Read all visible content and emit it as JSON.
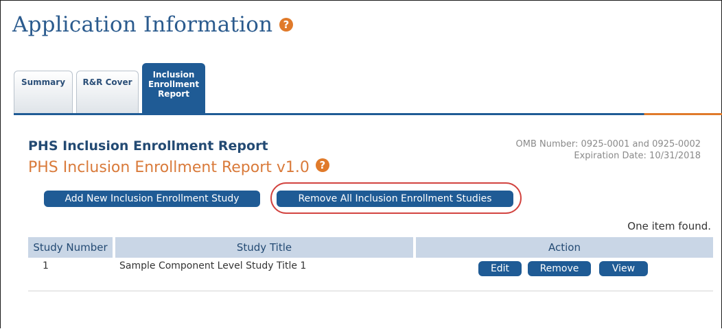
{
  "header": {
    "title": "Application Information",
    "help_icon": "?"
  },
  "tabs": [
    {
      "label": "Summary",
      "active": false
    },
    {
      "label": "R&R Cover",
      "active": false
    },
    {
      "label": "Inclusion Enrollment Report",
      "active": true
    }
  ],
  "report": {
    "title": "PHS Inclusion Enrollment Report",
    "subtitle": "PHS Inclusion Enrollment Report v1.0",
    "help_icon": "?",
    "omb_number": "OMB Number: 0925-0001 and 0925-0002",
    "expiration": "Expiration Date: 10/31/2018"
  },
  "actions": {
    "add_label": "Add New Inclusion Enrollment Study",
    "remove_all_label": "Remove All Inclusion Enrollment Studies"
  },
  "table": {
    "found_text": "One item found.",
    "columns": [
      "Study Number",
      "Study Title",
      "Action"
    ],
    "rows": [
      {
        "number": "1",
        "title": "Sample Component Level Study Title 1",
        "actions": [
          "Edit",
          "Remove",
          "View"
        ]
      }
    ]
  },
  "colors": {
    "accent": "#1f5b95",
    "highlight": "#d2433f",
    "subtitle": "#d97a3a",
    "header_bg": "#c9d6e6"
  }
}
